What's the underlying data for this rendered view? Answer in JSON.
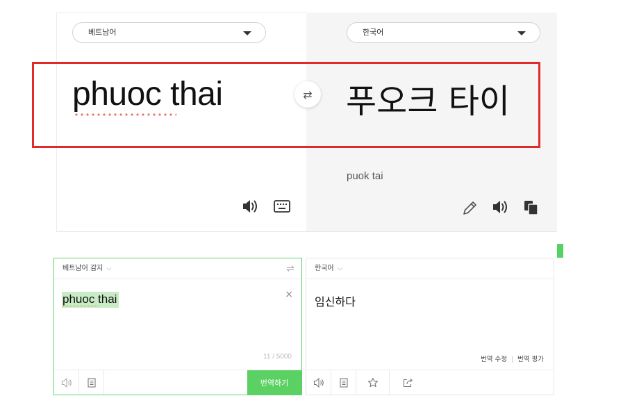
{
  "top": {
    "source_language": "베트남어",
    "target_language": "한국어",
    "source_text": "phuoc thai",
    "translated_text": "푸오크 타이",
    "romanization": "puok tai",
    "swap_glyph": "⇄"
  },
  "bottom": {
    "source_language": "베트남어 감지",
    "target_language": "한국어",
    "chevron": "⌵",
    "swap_glyph": "⇌",
    "source_text": "phuoc thai",
    "clear_glyph": "×",
    "char_count": "11 / 5000",
    "translated_text": "임신하다",
    "edit_translation_link": "번역 수정",
    "rate_translation_link": "번역 평가",
    "translate_button": "번역하기"
  },
  "colors": {
    "highlight_border": "#e32a2a",
    "naver_green": "#5bd163",
    "spell_underline": "#e7776e"
  },
  "icons": {
    "top_source": [
      "speaker-icon",
      "keyboard-icon"
    ],
    "top_target": [
      "pencil-icon",
      "speaker-icon",
      "copy-icon"
    ],
    "bottom_source": [
      "speaker-icon",
      "document-icon"
    ],
    "bottom_target": [
      "speaker-icon",
      "document-icon",
      "star-icon",
      "share-icon"
    ]
  }
}
